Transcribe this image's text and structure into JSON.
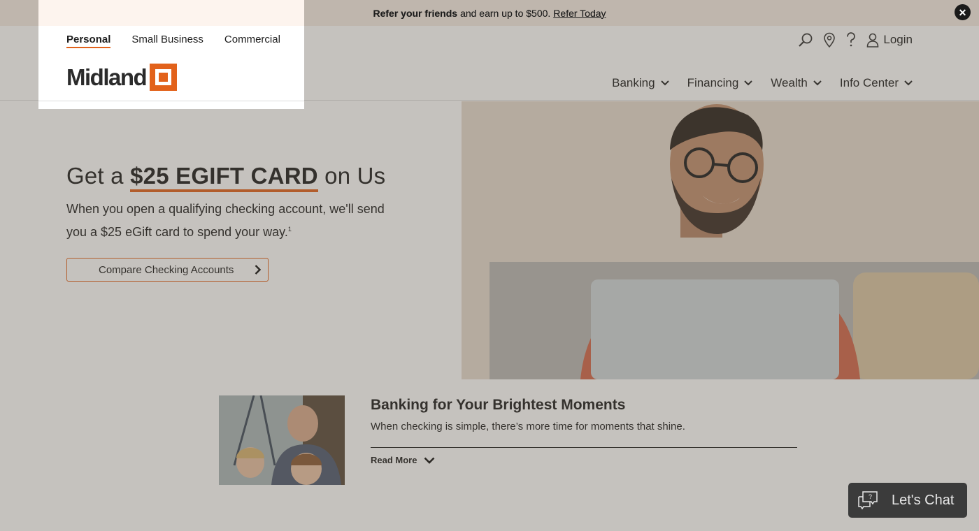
{
  "promo": {
    "bold": "Refer your friends",
    "text": "and earn up to $500.",
    "link": "Refer Today"
  },
  "segments": [
    "Personal",
    "Small Business",
    "Commercial"
  ],
  "brand": {
    "name": "Midland",
    "accent": "#e2621b"
  },
  "utility": {
    "login": "Login"
  },
  "nav": [
    "Banking",
    "Financing",
    "Wealth",
    "Info Center"
  ],
  "hero": {
    "title_pre": "Get a",
    "title_highlight": "$25 EGIFT CARD",
    "title_post": "on Us",
    "body_line1": "When you open a qualifying checking account, we'll send",
    "body_line2": "you a $25 eGift card to spend your way.",
    "footnote": "1",
    "cta": "Compare Checking Accounts"
  },
  "story": {
    "title": "Banking for Your Brightest Moments",
    "text": "When checking is simple, there’s more time for moments that shine.",
    "read_more": "Read More"
  },
  "chat": {
    "label": "Let's Chat"
  }
}
